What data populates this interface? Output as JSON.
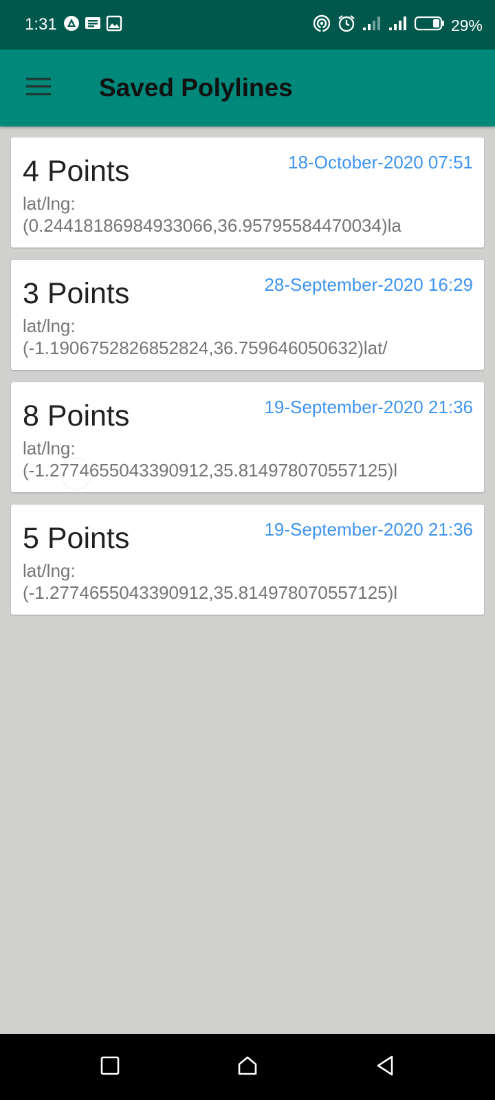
{
  "status_bar": {
    "time": "1:31",
    "battery_percent": "29%",
    "battery_level": 0.29,
    "left_icons": [
      "app-notification-icon",
      "message-notification-icon",
      "image-notification-icon"
    ],
    "right_icons": [
      "hotspot-icon",
      "alarm-icon",
      "signal-icon",
      "signal-icon",
      "battery-icon"
    ]
  },
  "app_bar": {
    "title": "Saved Polylines",
    "menu_icon": "menu-icon"
  },
  "polylines": [
    {
      "title": "4 Points",
      "date": "18-October-2020 07:51",
      "label": "lat/lng:",
      "coords": "(0.24418186984933066,36.95795584470034)la"
    },
    {
      "title": "3 Points",
      "date": "28-September-2020 16:29",
      "label": "lat/lng:",
      "coords": "(-1.1906752826852824,36.759646050632)lat/"
    },
    {
      "title": "8 Points",
      "date": "19-September-2020 21:36",
      "label": "lat/lng:",
      "coords": "(-1.2774655043390912,35.814978070557125)l"
    },
    {
      "title": "5 Points",
      "date": "19-September-2020 21:36",
      "label": "lat/lng:",
      "coords": "(-1.2774655043390912,35.814978070557125)l"
    }
  ],
  "nav_bar": {
    "buttons": [
      "recents-icon",
      "home-icon",
      "back-icon"
    ]
  },
  "colors": {
    "status_bar": "#00574b",
    "app_bar": "#00897b",
    "background": "#d0d1cf",
    "date_text": "#3f94f0",
    "secondary_text": "#757575"
  }
}
